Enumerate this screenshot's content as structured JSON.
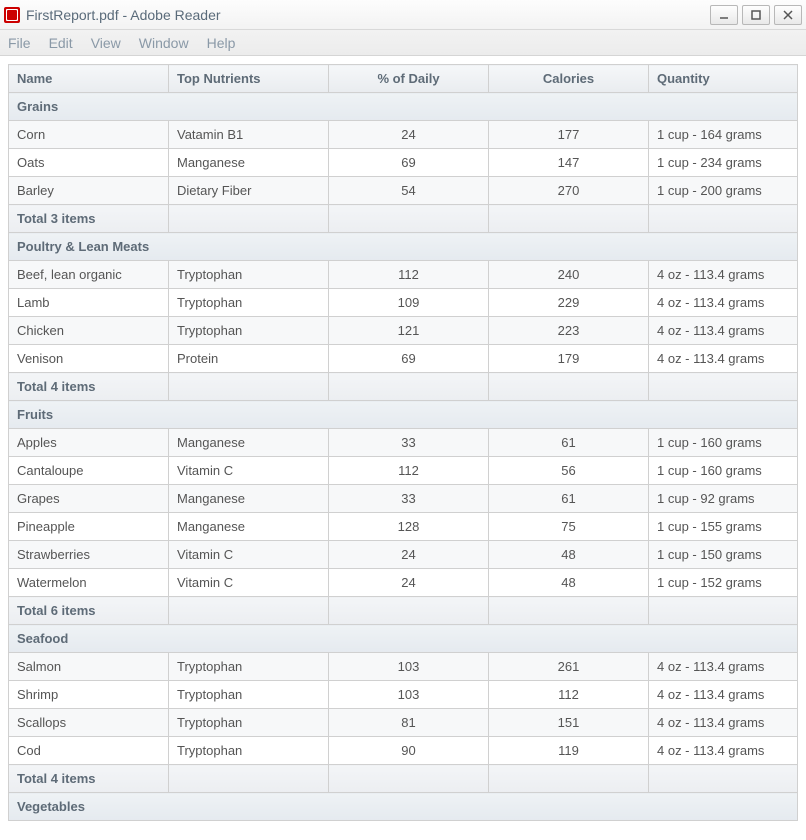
{
  "window": {
    "title": "FirstReport.pdf - Adobe Reader"
  },
  "menu": {
    "file": "File",
    "edit": "Edit",
    "view": "View",
    "window": "Window",
    "help": "Help"
  },
  "table": {
    "headers": {
      "name": "Name",
      "nutrients": "Top Nutrients",
      "daily": "% of Daily",
      "calories": "Calories",
      "quantity": "Quantity"
    },
    "groups": [
      {
        "title": "Grains",
        "rows": [
          {
            "name": "Corn",
            "nutrient": "Vatamin B1",
            "daily": "24",
            "calories": "177",
            "quantity": "1 cup - 164 grams"
          },
          {
            "name": "Oats",
            "nutrient": "Manganese",
            "daily": "69",
            "calories": "147",
            "quantity": "1 cup - 234 grams"
          },
          {
            "name": "Barley",
            "nutrient": "Dietary Fiber",
            "daily": "54",
            "calories": "270",
            "quantity": "1 cup - 200 grams"
          }
        ],
        "total": "Total 3 items"
      },
      {
        "title": "Poultry & Lean Meats",
        "rows": [
          {
            "name": "Beef, lean organic",
            "nutrient": "Tryptophan",
            "daily": "112",
            "calories": "240",
            "quantity": "4 oz - 113.4 grams"
          },
          {
            "name": "Lamb",
            "nutrient": "Tryptophan",
            "daily": "109",
            "calories": "229",
            "quantity": "4 oz - 113.4 grams"
          },
          {
            "name": "Chicken",
            "nutrient": "Tryptophan",
            "daily": "121",
            "calories": "223",
            "quantity": "4 oz - 113.4 grams"
          },
          {
            "name": "Venison",
            "nutrient": "Protein",
            "daily": "69",
            "calories": "179",
            "quantity": "4 oz - 113.4 grams"
          }
        ],
        "total": "Total 4 items"
      },
      {
        "title": "Fruits",
        "rows": [
          {
            "name": "Apples",
            "nutrient": "Manganese",
            "daily": "33",
            "calories": "61",
            "quantity": "1 cup - 160 grams"
          },
          {
            "name": "Cantaloupe",
            "nutrient": "Vitamin C",
            "daily": "112",
            "calories": "56",
            "quantity": "1 cup - 160 grams"
          },
          {
            "name": "Grapes",
            "nutrient": "Manganese",
            "daily": "33",
            "calories": "61",
            "quantity": "1 cup - 92 grams"
          },
          {
            "name": "Pineapple",
            "nutrient": "Manganese",
            "daily": "128",
            "calories": "75",
            "quantity": "1 cup - 155 grams"
          },
          {
            "name": "Strawberries",
            "nutrient": "Vitamin C",
            "daily": "24",
            "calories": "48",
            "quantity": "1 cup - 150 grams"
          },
          {
            "name": "Watermelon",
            "nutrient": "Vitamin C",
            "daily": "24",
            "calories": "48",
            "quantity": "1 cup - 152 grams"
          }
        ],
        "total": "Total 6 items"
      },
      {
        "title": "Seafood",
        "rows": [
          {
            "name": "Salmon",
            "nutrient": "Tryptophan",
            "daily": "103",
            "calories": "261",
            "quantity": "4 oz - 113.4 grams"
          },
          {
            "name": "Shrimp",
            "nutrient": "Tryptophan",
            "daily": "103",
            "calories": "112",
            "quantity": "4 oz - 113.4 grams"
          },
          {
            "name": "Scallops",
            "nutrient": "Tryptophan",
            "daily": "81",
            "calories": "151",
            "quantity": "4 oz - 113.4 grams"
          },
          {
            "name": "Cod",
            "nutrient": "Tryptophan",
            "daily": "90",
            "calories": "119",
            "quantity": "4 oz - 113.4 grams"
          }
        ],
        "total": "Total 4 items"
      },
      {
        "title": "Vegetables",
        "rows": [],
        "total": null
      }
    ]
  }
}
